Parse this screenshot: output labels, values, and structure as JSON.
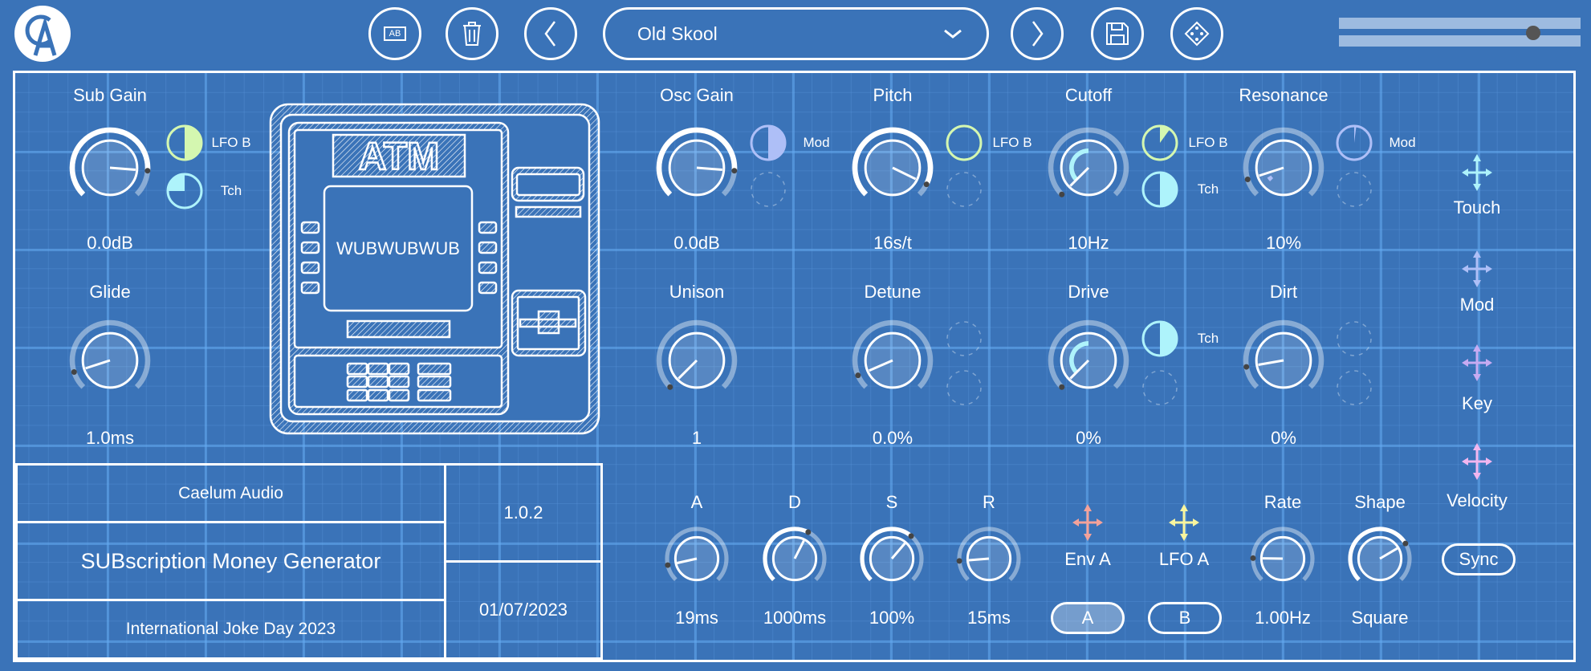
{
  "header": {
    "logo_text": "CA",
    "preset_name": "Old Skool",
    "buttons": {
      "ab": "AB"
    }
  },
  "colors": {
    "background": "#3a73b8",
    "lfo_b": "#d4f7b0",
    "touch": "#aef3fb",
    "mod": "#aebff7",
    "key": "#c7abf2",
    "velocity": "#f2b6ef",
    "env_a": "#f4a29a",
    "lfo_a": "#f8f59e"
  },
  "volume": {
    "value": 0.8
  },
  "atm": {
    "title": "ATM",
    "screen_text": "WUBWUBWUB"
  },
  "knobs": {
    "sub_gain": {
      "label": "Sub Gain",
      "value": "0.0dB",
      "fraction": 0.85,
      "bold": true
    },
    "glide": {
      "label": "Glide",
      "value": "1.0ms",
      "fraction": 0.1
    },
    "osc_gain": {
      "label": "Osc Gain",
      "value": "0.0dB",
      "fraction": 0.85,
      "bold": true
    },
    "pitch": {
      "label": "Pitch",
      "value": "16s/t",
      "fraction": 0.93,
      "bold": true
    },
    "cutoff": {
      "label": "Cutoff",
      "value": "10Hz",
      "fraction": 0.0,
      "mod_arcs": [
        {
          "color": "#d4f7b0",
          "fraction": 0.12
        },
        {
          "color": "#aef3fb",
          "fraction": 0.5
        }
      ]
    },
    "resonance": {
      "label": "Resonance",
      "value": "10%",
      "fraction": 0.1,
      "bold": false,
      "mod_arcs": [
        {
          "color": "#aebff7",
          "fraction": 0.05
        }
      ]
    },
    "unison": {
      "label": "Unison",
      "value": "1",
      "fraction": 0.0
    },
    "detune": {
      "label": "Detune",
      "value": "0.0%",
      "fraction": 0.08
    },
    "drive": {
      "label": "Drive",
      "value": "0%",
      "fraction": 0.0,
      "mod_arcs": [
        {
          "color": "#aef3fb",
          "fraction": 0.5
        }
      ]
    },
    "dirt": {
      "label": "Dirt",
      "value": "0%",
      "fraction": 0.13
    },
    "attack": {
      "label": "A",
      "value": "19ms",
      "fraction": 0.12
    },
    "decay": {
      "label": "D",
      "value": "1000ms",
      "fraction": 0.6,
      "bold": true
    },
    "sustain": {
      "label": "S",
      "value": "100%",
      "fraction": 0.65,
      "bold": true
    },
    "release": {
      "label": "R",
      "value": "15ms",
      "fraction": 0.15
    },
    "rate": {
      "label": "Rate",
      "value": "1.00Hz",
      "fraction": 0.17
    },
    "shape": {
      "label": "Shape",
      "value": "Square",
      "fraction": 0.72,
      "bold": true
    }
  },
  "mods": {
    "sub_gain_1": {
      "label": "LFO B",
      "color": "#d4f7b0",
      "amount": 0.5
    },
    "sub_gain_2": {
      "label": "Tch",
      "color": "#aef3fb",
      "amount": -0.25
    },
    "osc_gain_1": {
      "label": "Mod",
      "color": "#aebff7",
      "amount": 0.5
    },
    "pitch_1": {
      "label": "LFO B",
      "color": "#d4f7b0",
      "amount": 0
    },
    "cutoff_1": {
      "label": "LFO B",
      "color": "#d4f7b0",
      "amount": 0.1
    },
    "cutoff_2": {
      "label": "Tch",
      "color": "#aef3fb",
      "amount": 0.5
    },
    "resonance_1": {
      "label": "Mod",
      "color": "#aebff7",
      "amount": 0.02
    },
    "drive_1": {
      "label": "Tch",
      "color": "#aef3fb",
      "amount": 0.5
    }
  },
  "sources": {
    "touch": "Touch",
    "mod": "Mod",
    "key": "Key",
    "velocity": "Velocity",
    "env_a": "Env A",
    "lfo_a": "LFO A"
  },
  "buttons": {
    "a": "A",
    "b": "B",
    "sync": "Sync"
  },
  "info": {
    "company": "Caelum Audio",
    "product": "SUBscription Money Generator",
    "edition": "International Joke Day 2023",
    "version": "1.0.2",
    "date": "01/07/2023"
  }
}
